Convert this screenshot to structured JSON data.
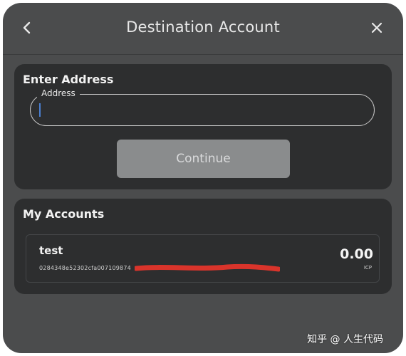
{
  "header": {
    "title": "Destination Account",
    "back_icon": "chevron-left-icon",
    "close_icon": "close-icon"
  },
  "address_section": {
    "heading": "Enter Address",
    "field_label": "Address",
    "field_value": "",
    "continue_label": "Continue"
  },
  "accounts_section": {
    "heading": "My Accounts",
    "accounts": [
      {
        "name": "test",
        "address": "0284348e52302cfa007109874",
        "balance": "0.00",
        "unit": "ICP"
      }
    ]
  },
  "watermark": "知乎 @ 人生代码",
  "colors": {
    "modal_bg": "#4b4c4d",
    "card_bg": "#2d2e2f",
    "button_bg": "#8a8c8d",
    "redaction": "#d9342b",
    "caret": "#4a7fd0"
  }
}
